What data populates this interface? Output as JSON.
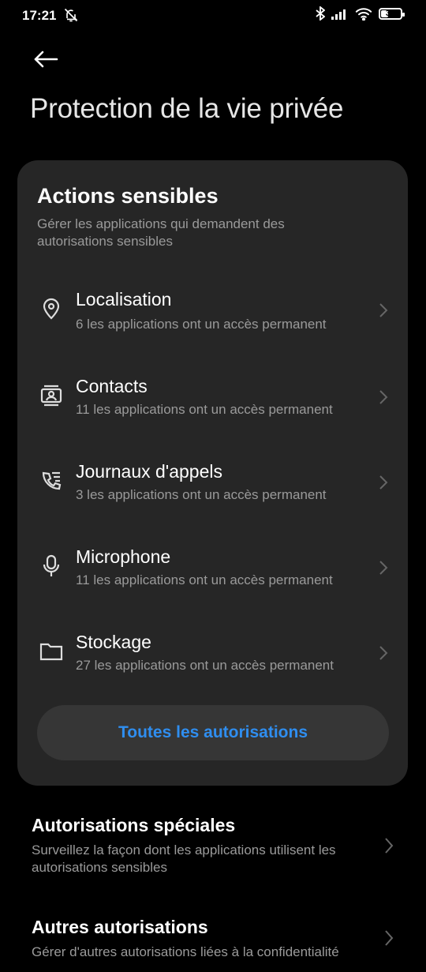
{
  "status_bar": {
    "time": "17:21",
    "battery": "36",
    "battery_level": 0.36
  },
  "header": {
    "title": "Protection de la vie privée"
  },
  "card": {
    "title": "Actions sensibles",
    "subtitle": "Gérer les applications qui demandent des autorisations sensibles",
    "items": [
      {
        "label": "Localisation",
        "desc": "6 les applications ont un accès permanent",
        "icon": "location-pin-icon"
      },
      {
        "label": "Contacts",
        "desc": "11 les applications ont un accès permanent",
        "icon": "contacts-icon"
      },
      {
        "label": "Journaux d'appels",
        "desc": "3 les applications ont un accès permanent",
        "icon": "call-log-icon"
      },
      {
        "label": "Microphone",
        "desc": "11 les applications ont un accès permanent",
        "icon": "microphone-icon"
      },
      {
        "label": "Stockage",
        "desc": "27 les applications ont un accès permanent",
        "icon": "folder-icon"
      }
    ],
    "all_button": "Toutes les autorisations"
  },
  "sections": [
    {
      "title": "Autorisations spéciales",
      "desc": "Surveillez la façon dont les applications utilisent les autorisations sensibles"
    },
    {
      "title": "Autres autorisations",
      "desc": "Gérer d'autres autorisations liées à la confidentialité"
    }
  ],
  "colors": {
    "accent": "#2f8ef0",
    "card_bg": "#262626",
    "button_bg": "#363636",
    "secondary_text": "#9a9a9a"
  }
}
